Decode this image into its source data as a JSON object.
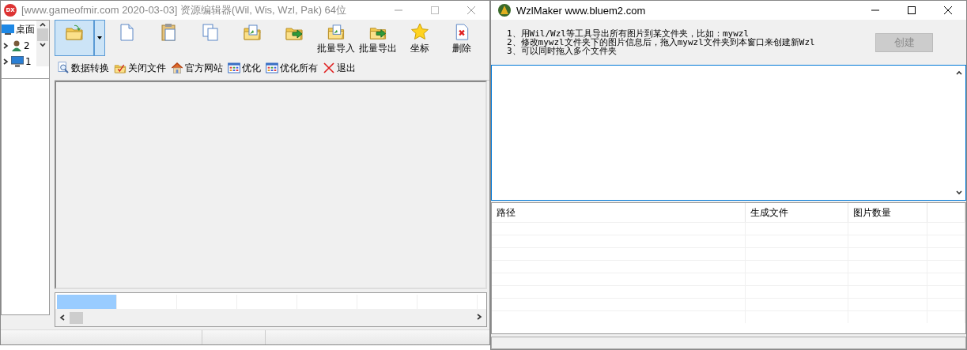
{
  "left_window": {
    "title": "[www.gameofmir.com 2020-03-03] 资源编辑器(Wil, Wis, Wzl, Pak)  64位",
    "app_badge": "DX",
    "tree": [
      {
        "label": "桌面",
        "kind": "desktop"
      },
      {
        "label": "2",
        "kind": "user"
      },
      {
        "label": "1",
        "kind": "computer"
      }
    ],
    "toolbar_top": [
      {
        "selected": true
      },
      {
        "selected": false
      },
      {
        "selected": false
      },
      {
        "selected": false
      },
      {
        "selected": false
      },
      {
        "selected": false
      },
      {
        "label": "批量导入",
        "selected": false
      },
      {
        "label": "批量导出",
        "selected": false
      },
      {
        "label": "坐标",
        "selected": false
      },
      {
        "label": "删除",
        "selected": false
      }
    ],
    "toolbar_bottom": [
      {
        "label": "数据转换"
      },
      {
        "label": "关闭文件"
      },
      {
        "label": "官方网站"
      },
      {
        "label": "优化"
      },
      {
        "label": "优化所有"
      },
      {
        "label": "退出"
      }
    ],
    "strip_cells": [
      {
        "selected": true
      },
      {
        "selected": false
      },
      {
        "selected": false
      },
      {
        "selected": false
      },
      {
        "selected": false
      },
      {
        "selected": false
      },
      {
        "selected": false
      }
    ]
  },
  "right_window": {
    "title": "WzlMaker www.bluem2.com",
    "instructions": [
      "1、用Wil/Wzl等工具导出所有图片到某文件夹，比如：mywzl",
      "2、修改mywzl文件夹下的图片信息后，拖入mywzl文件夹到本窗口来创建新Wzl",
      "3、可以同时拖入多个文件夹"
    ],
    "create_button": {
      "label": "创建",
      "disabled": true
    },
    "table": {
      "columns": [
        "路径",
        "生成文件",
        "图片数量"
      ]
    }
  }
}
